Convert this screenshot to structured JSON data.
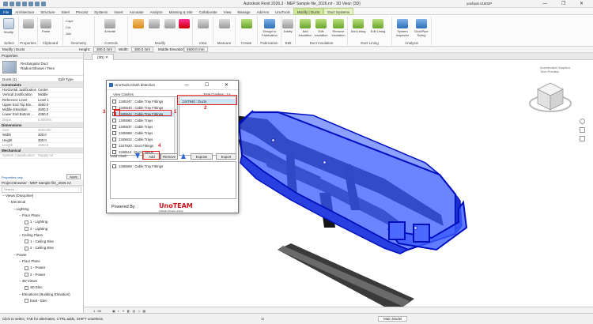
{
  "window": {
    "title": "Autodesk Revit 2026.3 - MEP Sample file_2026.rvt - 3D View: {3D}",
    "user": "yashpat.s1602P",
    "controls": "— ❐ ✕"
  },
  "ribbon_tabs": [
    "File",
    "Architecture",
    "Structure",
    "Steel",
    "Precast",
    "Systems",
    "Insert",
    "Annotate",
    "Analyze",
    "Massing & Site",
    "Collaborate",
    "View",
    "Manage",
    "Add-Ins",
    "UnoTools",
    "Modify | Ducts",
    "Duct Systems"
  ],
  "ribbon": {
    "modify": "Modify",
    "groups": [
      "Select",
      "Properties",
      "Clipboard",
      "Geometry",
      "Controls",
      "Modify",
      "View",
      "Measure",
      "Create",
      "Fabrication",
      "Edit",
      "Duct Insulation",
      "Duct Lining",
      "Analysis"
    ],
    "small": {
      "paste": "Paste",
      "cope": "Cope",
      "cut": "Cut",
      "join": "Join"
    },
    "buttons": {
      "activate": "Activate",
      "design_to_fab": "Design to Fabrication",
      "justify": "Justify",
      "add_insulation": "Add Insulation",
      "edit_insulation": "Edit Insulation",
      "remove_insulation": "Remove Insulation",
      "add_lining": "Add Lining",
      "edit_lining": "Edit Lining",
      "system_inspector": "System Inspector",
      "duct_pipe_sizing": "Duct/Pipe Sizing"
    }
  },
  "options_bar": {
    "context": "Modify | Ducts",
    "height_label": "Height:",
    "height_value": "300.0 mm",
    "width_label": "Width:",
    "width_value": "300.0 mm",
    "middle_label": "Middle Elevation:",
    "middle_value": "4500.0 mm"
  },
  "properties": {
    "header": "Properties",
    "type_name": "Rectangular Duct",
    "type_sub": "Radius Elbows / Tees",
    "selector": "Ducts (1)",
    "edit_type": "Edit Type",
    "sections": [
      {
        "name": "Constraints",
        "rows": [
          {
            "n": "Horizontal Justification",
            "v": "Center",
            "dim": false
          },
          {
            "n": "Vertical Justification",
            "v": "Middle",
            "dim": false
          },
          {
            "n": "Reference Level",
            "v": "Level 1",
            "dim": false
          },
          {
            "n": "Upper End Top Ele...",
            "v": "4650.0",
            "dim": false
          },
          {
            "n": "Middle Elevation",
            "v": "4500.0",
            "dim": false
          },
          {
            "n": "Lower End Bottom ...",
            "v": "4350.0",
            "dim": false
          },
          {
            "n": "Slope",
            "v": "0.0000%",
            "dim": true
          }
        ]
      },
      {
        "name": "Dimensions",
        "rows": [
          {
            "n": "Size",
            "v": "300x300",
            "dim": true
          },
          {
            "n": "Width",
            "v": "300.0",
            "dim": false
          },
          {
            "n": "Height",
            "v": "300.0",
            "dim": false
          },
          {
            "n": "Length",
            "v": "1660.6",
            "dim": true
          }
        ]
      },
      {
        "name": "Mechanical",
        "rows": [
          {
            "n": "System Classification",
            "v": "Supply Air",
            "dim": true
          }
        ]
      }
    ],
    "help": "Properties help",
    "apply": "Apply"
  },
  "browser": {
    "header": "Project Browser - MEP Sample file_2026.rvt",
    "search": "Search",
    "nodes": [
      {
        "t": "Views (Discipline)",
        "lvl": 0,
        "cb": false
      },
      {
        "t": "Electrical",
        "lvl": 1,
        "cb": false
      },
      {
        "t": "Lighting",
        "lvl": 2,
        "cb": false
      },
      {
        "t": "Floor Plans",
        "lvl": 3,
        "cb": false
      },
      {
        "t": "1 - Lighting",
        "lvl": 4,
        "cb": true
      },
      {
        "t": "2 - Lighting",
        "lvl": 4,
        "cb": true
      },
      {
        "t": "Ceiling Plans",
        "lvl": 3,
        "cb": false
      },
      {
        "t": "1 - Ceiling Elec",
        "lvl": 4,
        "cb": true
      },
      {
        "t": "2 - Ceiling Elec",
        "lvl": 4,
        "cb": true
      },
      {
        "t": "Power",
        "lvl": 2,
        "cb": false
      },
      {
        "t": "Floor Plans",
        "lvl": 3,
        "cb": false
      },
      {
        "t": "1 - Power",
        "lvl": 4,
        "cb": true
      },
      {
        "t": "2 - Power",
        "lvl": 4,
        "cb": true
      },
      {
        "t": "3D Views",
        "lvl": 3,
        "cb": false
      },
      {
        "t": "3D Elec",
        "lvl": 4,
        "cb": true
      },
      {
        "t": "Elevations (Building Elevation)",
        "lvl": 3,
        "cb": false
      },
      {
        "t": "East - Elec",
        "lvl": 4,
        "cb": true
      }
    ]
  },
  "view": {
    "tab": "{3D}",
    "close": "✕",
    "scale": "1 : 50",
    "nav_text": "Accelerated Graphics\nTech Preview"
  },
  "status": {
    "hint": "Click to select, TAB for alternates, CTRL adds, SHIFT unselects.",
    "model": "Main Model",
    "count": ":0"
  },
  "dialog": {
    "title": "UnoTools Clash detection",
    "win": "— ☐ ✕",
    "view_clashes": "View Clashes",
    "total_clashes": "Total Clashes : 14",
    "clashes": [
      {
        "id": "1345347",
        "type": "Cable Tray Fittings",
        "checked": false,
        "selected": false
      },
      {
        "id": "1345540",
        "type": "Cable Tray Fittings",
        "checked": false,
        "selected": false
      },
      {
        "id": "1345544",
        "type": "Cable Tray Fittings",
        "checked": false,
        "selected": true
      },
      {
        "id": "1345580",
        "type": "Cable Trays",
        "checked": false,
        "selected": false
      },
      {
        "id": "1345537",
        "type": "Cable Trays",
        "checked": false,
        "selected": false
      },
      {
        "id": "1345588",
        "type": "Cable Trays",
        "checked": false,
        "selected": false
      },
      {
        "id": "1345622",
        "type": "Cable Trays",
        "checked": false,
        "selected": false
      },
      {
        "id": "1347920",
        "type": "Duct Fittings",
        "checked": false,
        "selected": false
      },
      {
        "id": "1348114",
        "type": "Duct Fittings",
        "checked": false,
        "selected": false
      }
    ],
    "total_item": "1347940 : Ducts",
    "valid_clash": "Valid Clash",
    "add": "Add",
    "remove": "Remove",
    "expose": "Expose",
    "export": "Export",
    "valid_items": [
      {
        "id": "1345559",
        "type": "Cable Tray Fittings"
      }
    ],
    "powered_by": "Powered By",
    "logo": "UnoTEAM",
    "logo_sub": "Software Private Limited"
  },
  "annotations": {
    "a1": "1",
    "a2": "2",
    "a3": "3",
    "a4": "4"
  },
  "colors": {
    "duct_fill": "#3b5bff",
    "duct_edge": "#0010c0",
    "tray": "#111111",
    "accent_red": "#e02020",
    "ribbon_blue": "#1f5fa8"
  }
}
